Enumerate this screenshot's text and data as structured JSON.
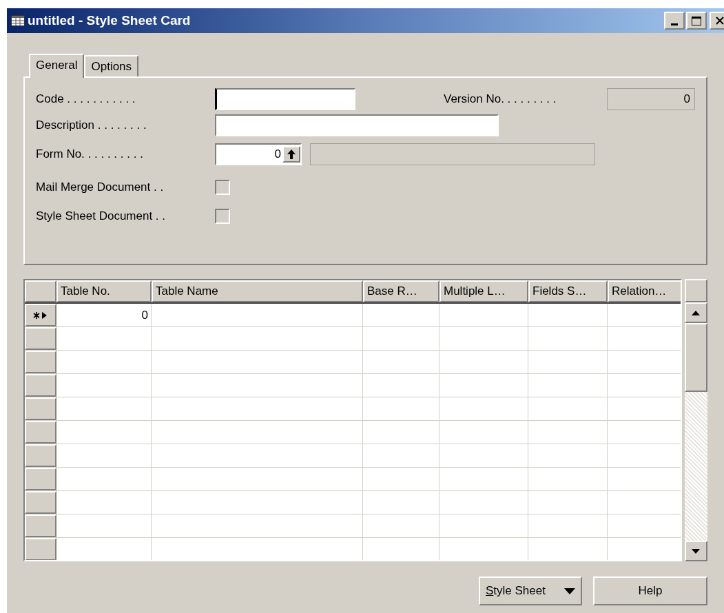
{
  "window": {
    "title": "untitled - Style Sheet Card"
  },
  "tabs": [
    {
      "label": "General",
      "selected": true
    },
    {
      "label": "Options",
      "selected": false
    }
  ],
  "fields": {
    "code": {
      "label": "Code . . . . . . . . . . .",
      "focused": true
    },
    "version_no": {
      "label": "Version No. . . . . . . . .",
      "value": "0",
      "disabled": true
    },
    "description": {
      "label": "Description . . . . . . . ."
    },
    "form_no": {
      "label": "Form No. . . . . . . . . .",
      "value": "0"
    },
    "mail_merge_document": {
      "label": "Mail Merge Document . .",
      "checked": false
    },
    "style_sheet_document": {
      "label": "Style Sheet Document . .",
      "checked": false
    }
  },
  "table": {
    "columns": [
      "Table No.",
      "Table Name",
      "Base R…",
      "Multiple L…",
      "Fields S…",
      "Relation…"
    ],
    "rows": [
      {
        "table_no": "0",
        "current": true
      }
    ]
  },
  "buttons": [
    {
      "label": "Style Sheet",
      "kind": "menu"
    },
    {
      "label": "Help",
      "kind": "plain"
    }
  ]
}
